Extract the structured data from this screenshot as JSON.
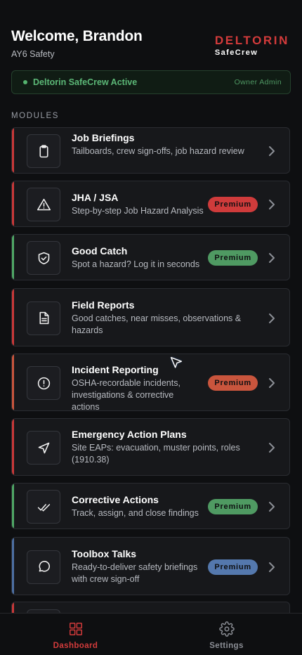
{
  "header": {
    "welcome": "Welcome, Brandon",
    "org": "AY6 Safety",
    "brand_name": "DELTORIN",
    "brand_sub": "SafeCrew"
  },
  "status": {
    "text": "Deltorin SafeCrew Active",
    "role": "Owner Admin",
    "color": "#5cb877"
  },
  "section_label": "MODULES",
  "modules": [
    {
      "title": "Job Briefings",
      "desc": "Tailboards, crew sign-offs, job hazard review",
      "icon": "clipboard-icon",
      "accent": "#c93838",
      "badge": ""
    },
    {
      "title": "JHA / JSA",
      "desc": "Step-by-step Job Hazard Analysis",
      "icon": "warning-triangle-icon",
      "accent": "#c93838",
      "badge": "Premium",
      "badge_color": "#cf3b3b"
    },
    {
      "title": "Good Catch",
      "desc": "Spot a hazard? Log it in seconds",
      "icon": "shield-check-icon",
      "accent": "#4fa765",
      "badge": "Premium",
      "badge_color": "#4f9a62"
    },
    {
      "title": "Field Reports",
      "desc": "Good catches, near misses, observations & hazards",
      "icon": "document-icon",
      "accent": "#c93838",
      "badge": ""
    },
    {
      "title": "Incident Reporting",
      "desc": "OSHA-recordable incidents, investigations & corrective actions",
      "icon": "alert-circle-icon",
      "accent": "#c9553d",
      "badge": "Premium",
      "badge_color": "#c9553d"
    },
    {
      "title": "Emergency Action Plans",
      "desc": "Site EAPs: evacuation, muster points, roles (1910.38)",
      "icon": "navigation-arrow-icon",
      "accent": "#c93838",
      "badge": ""
    },
    {
      "title": "Corrective Actions",
      "desc": "Track, assign, and close findings",
      "icon": "double-check-icon",
      "accent": "#4fa765",
      "badge": "Premium",
      "badge_color": "#4f9a62"
    },
    {
      "title": "Toolbox Talks",
      "desc": "Ready-to-deliver safety briefings with crew sign-off",
      "icon": "chat-bubble-icon",
      "accent": "#4d6fa3",
      "badge": "Premium",
      "badge_color": "#5478ad"
    }
  ],
  "tabs": [
    {
      "label": "Dashboard",
      "icon": "dashboard-grid-icon",
      "active": true,
      "color": "#d33b3b"
    },
    {
      "label": "Settings",
      "icon": "gear-icon",
      "active": false,
      "color": "#8c8f96"
    }
  ]
}
